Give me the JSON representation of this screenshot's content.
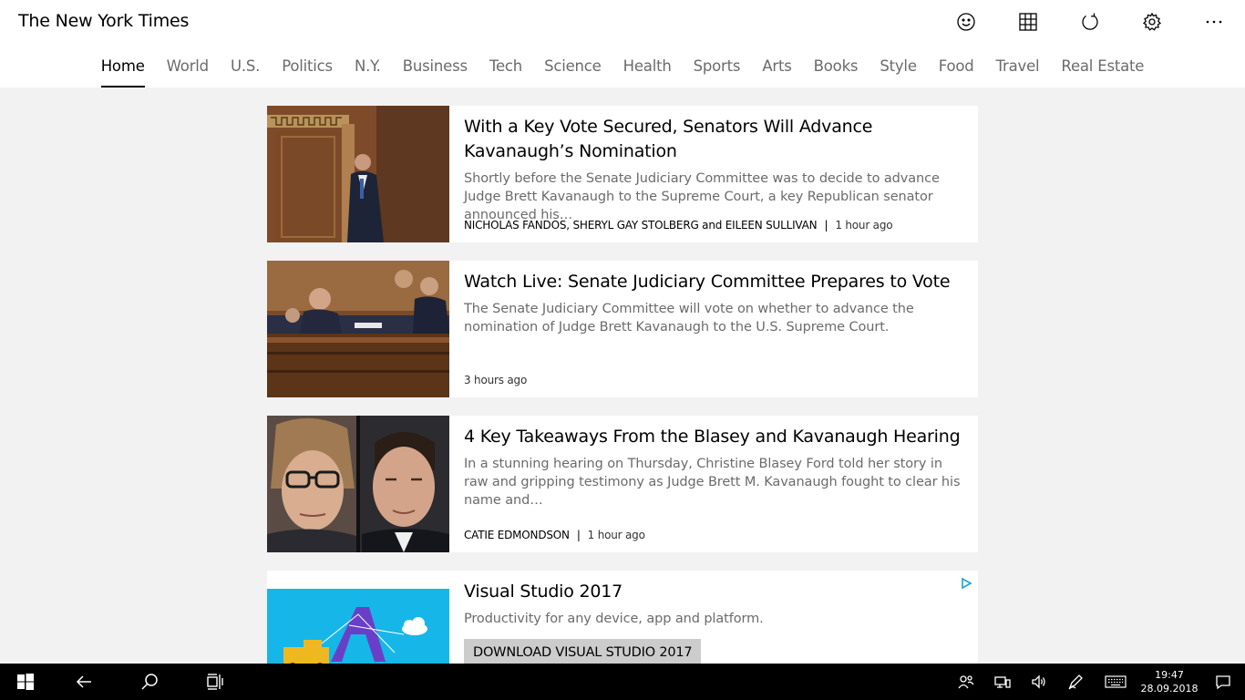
{
  "app": {
    "title": "The New York Times"
  },
  "header": {
    "icons": [
      "smiley-icon",
      "grid-icon",
      "refresh-icon",
      "settings-gear-icon",
      "more-options-icon"
    ],
    "more_label": "···"
  },
  "nav": {
    "items": [
      "Home",
      "World",
      "U.S.",
      "Politics",
      "N.Y.",
      "Business",
      "Tech",
      "Science",
      "Health",
      "Sports",
      "Arts",
      "Books",
      "Style",
      "Food",
      "Travel",
      "Real Estate"
    ],
    "active": "Home"
  },
  "articles": [
    {
      "headline": "With a Key Vote Secured, Senators Will Advance Kavanaugh’s Nomination",
      "summary": "Shortly before the Senate Judiciary Committee was to decide to advance Judge Brett Kavanaugh to the Supreme Court, a key Republican senator announced his…",
      "byline": "NICHOLAS FANDOS, SHERYL GAY STOLBERG and EILEEN SULLIVAN",
      "time": "1 hour ago"
    },
    {
      "headline": "Watch Live: Senate Judiciary Committee Prepares to Vote",
      "summary": "The Senate Judiciary Committee will vote on whether to advance the nomination of Judge Brett Kavanaugh to the U.S. Supreme Court.",
      "byline": "",
      "time": "3 hours ago"
    },
    {
      "headline": "4 Key Takeaways From the Blasey and Kavanaugh Hearing",
      "summary": "In a stunning hearing on Thursday, Christine Blasey Ford told her story in raw and gripping testimony as Judge Brett M. Kavanaugh fought to clear his name and…",
      "byline": "CATIE EDMONDSON",
      "time": "1 hour ago"
    }
  ],
  "ad": {
    "title": "Visual Studio 2017",
    "tagline": "Productivity for any device, app and platform.",
    "button_label": "DOWNLOAD VISUAL STUDIO 2017"
  },
  "taskbar": {
    "clock_time": "19:47",
    "clock_date": "28.09.2018"
  },
  "colors": {
    "background": "#f2f2f2",
    "card": "#ffffff",
    "muted_text": "#6b6b6b",
    "taskbar": "#000000",
    "ad_blue": "#17b6e8",
    "ad_purple": "#6a3fc8"
  }
}
